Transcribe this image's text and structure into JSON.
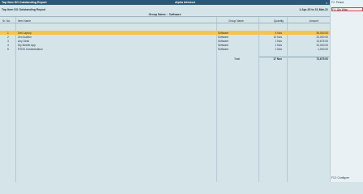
{
  "titlebar": {
    "left": "Top Item SO Outstanding Report",
    "center": "Alpha Infotech",
    "close": "×"
  },
  "report": {
    "title": "Top Item SO Outstanding Report",
    "period": "1-Apr-20 to 31-Mar-21",
    "group_label": "Group Name :",
    "group_value": "Software"
  },
  "table": {
    "headers": {
      "sr": "Sr. No.",
      "item": "Item Name",
      "group": "Group Name",
      "qty": "Quantity",
      "amount": "Amount"
    },
    "rows": [
      {
        "sr": "1",
        "item": "Dell Laptop",
        "group": "Software",
        "qty": "4 Nos",
        "amount": "36,000.00"
      },
      {
        "sr": "2",
        "item": "Zen Auditor",
        "group": "Software",
        "qty": "10 Nos",
        "amount": "23,000.00"
      },
      {
        "sr": "3",
        "item": "Any Desk",
        "group": "Software",
        "qty": "1 Nos",
        "amount": "13,675.00"
      },
      {
        "sr": "4",
        "item": "Diy Mobile App",
        "group": "Software",
        "qty": "1 Nos",
        "amount": "10,000.00"
      },
      {
        "sr": "5",
        "item": "RTDS Customization",
        "group": "Software",
        "qty": "1 Nos",
        "amount": "1,000.00"
      }
    ],
    "selected_row": 0,
    "total": {
      "label": "Total",
      "qty": "17 Nos",
      "amount": "73,675.00"
    }
  },
  "sidebar": {
    "items": [
      {
        "key": "F2:",
        "label": "Period"
      },
      {
        "key": "F4:",
        "label": "Qty Wise"
      }
    ],
    "active_index": 1,
    "bottom": {
      "key": "F12:",
      "label": "Configure"
    }
  },
  "colors": {
    "titlebar": "#2c5877",
    "selected_row": "#f3c54f",
    "background": "#d4e4e9",
    "active_border": "#c84a4a"
  }
}
